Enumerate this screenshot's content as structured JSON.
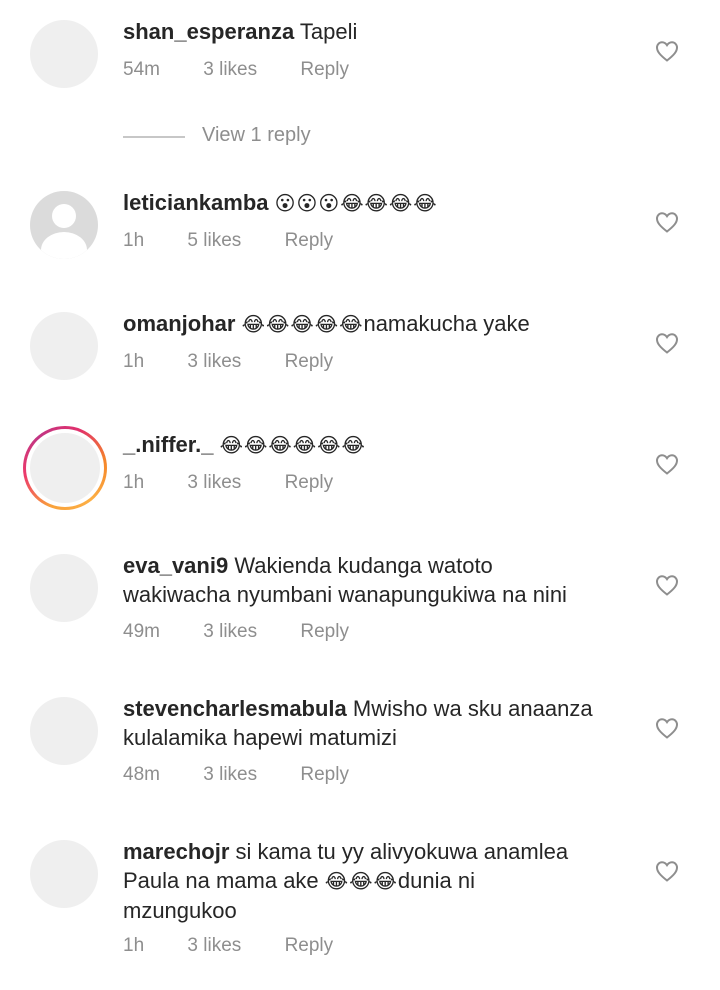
{
  "comments": [
    {
      "username": "shan_esperanza",
      "text": "Tapeli",
      "emoji": "",
      "time": "54m",
      "likes": "3 likes",
      "reply": "Reply"
    },
    {
      "username": "leticiankamba",
      "text": "",
      "emoji": "😮😮😮😂😂😂😂",
      "time": "1h",
      "likes": "5 likes",
      "reply": "Reply"
    },
    {
      "username": "omanjohar",
      "text": "namakucha yake",
      "emoji": "😂😂😂😂😂",
      "time": "1h",
      "likes": "3 likes",
      "reply": "Reply"
    },
    {
      "username": "_.niffer._",
      "text": "",
      "emoji": "😂😂😂😂😂😂",
      "time": "1h",
      "likes": "3 likes",
      "reply": "Reply"
    },
    {
      "username": "eva_vani9",
      "text_line1": "Wakienda kudanga watoto",
      "text_line2": "wakiwacha nyumbani wanapungukiwa na nini",
      "time": "49m",
      "likes": "3 likes",
      "reply": "Reply"
    },
    {
      "username": "stevencharlesmabula",
      "text_line1": "Mwisho wa sku anaanza",
      "text_line2": "kulalamika hapewi matumizi",
      "time": "48m",
      "likes": "3 likes",
      "reply": "Reply"
    },
    {
      "username": "marechojr",
      "text_line1": "si kama tu yy alivyokuwa anamlea",
      "text_line2_pre": "Paula na mama ake",
      "emoji": "😂😂😂",
      "text_line2_post": "dunia ni",
      "text_line3": "mzungukoo",
      "time": "1h",
      "likes": "3 likes",
      "reply": "Reply"
    }
  ],
  "view_replies": {
    "label": "View 1 reply"
  },
  "icons": {
    "like": "heart-outline-icon",
    "default_avatar": "default-avatar-icon"
  }
}
